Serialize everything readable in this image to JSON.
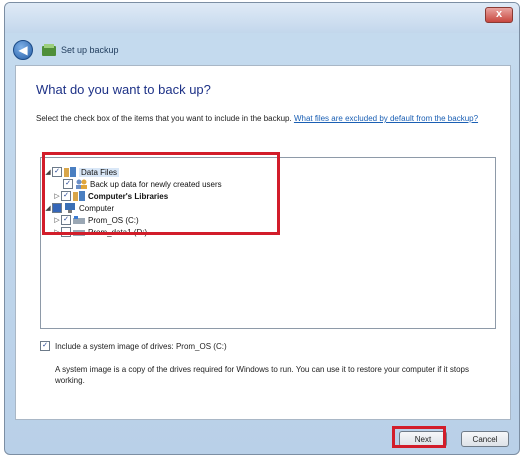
{
  "window": {
    "close_label": "x"
  },
  "nav": {
    "title": "Set up backup"
  },
  "heading": "What do you want to back up?",
  "description": {
    "text": "Select the check box of the items that you want to include in the backup. ",
    "link": "What files are excluded by default from the backup?"
  },
  "tree": {
    "items": [
      {
        "label": "Data Files"
      },
      {
        "label": "Back up data for newly created users"
      },
      {
        "label": "Computer's Libraries"
      },
      {
        "label": "Computer"
      },
      {
        "label": "Prom_OS (C:)"
      },
      {
        "label": "Prom_data1 (D:)"
      }
    ]
  },
  "system_image": {
    "label": "Include a system image of drives: Prom_OS (C:)",
    "checked": true,
    "description": "A system image is a copy of the drives required for Windows to run. You can use it to restore your computer if it stops working."
  },
  "buttons": {
    "next": "Next",
    "cancel": "Cancel"
  },
  "colors": {
    "highlight": "#d21d2a",
    "link": "#1a5fb4",
    "heading": "#1e3287"
  }
}
